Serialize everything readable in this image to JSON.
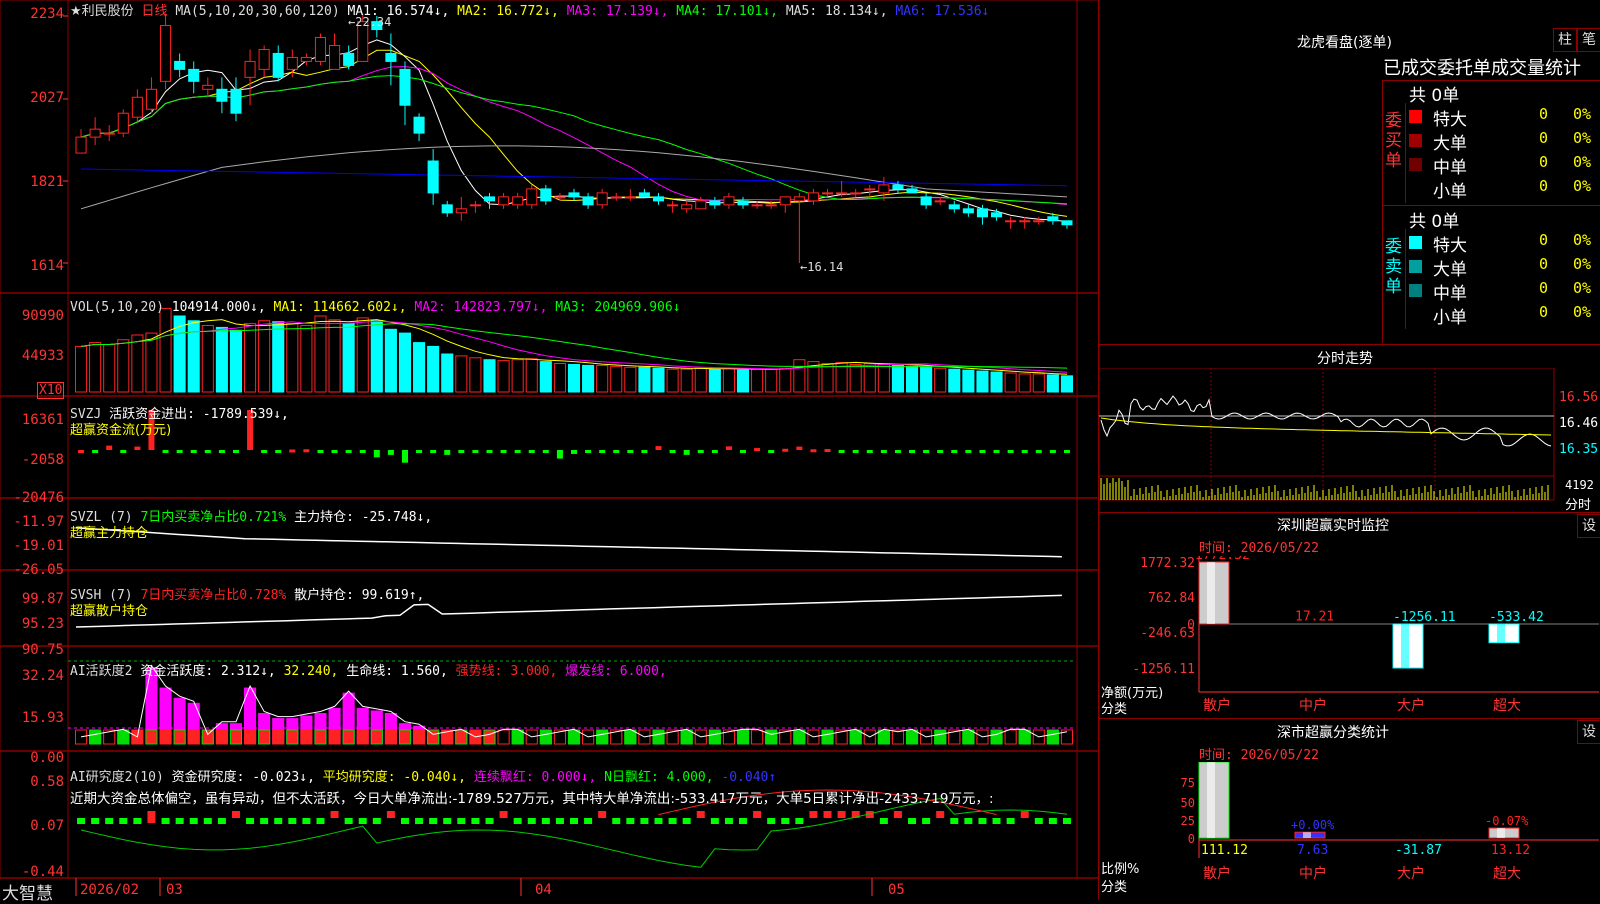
{
  "colors": {
    "up": "#ff2222",
    "down": "#00ffff",
    "bg": "#000000",
    "grid": "#8b0000",
    "ma1": "#ffffff",
    "ma2": "#ffff00",
    "ma3": "#ff00ff",
    "ma4": "#00ff00",
    "ma5": "#aaaaaa",
    "ma6": "#0000ff"
  },
  "header": {
    "stock": "★利民股份",
    "period": "日线",
    "ma_params": "MA(5,10,20,30,60,120)",
    "ma1": "MA1: 16.574↓,",
    "ma2": "MA2: 16.772↓,",
    "ma3": "MA3: 17.139↓,",
    "ma4": "MA4: 17.101↓,",
    "ma5": "MA5: 18.134↓,",
    "ma6": "MA6: 17.536↓"
  },
  "main_axis": {
    "ticks": [
      "2234",
      "2027",
      "1821",
      "1614"
    ]
  },
  "annotations": {
    "high": "←22.34",
    "low": "←16.14"
  },
  "vol": {
    "title": "VOL(5,10,20)",
    "value": "104914.000↓,",
    "ma1": "MA1: 114662.602↓,",
    "ma2": "MA2: 142823.797↓,",
    "ma3": "MA3: 204969.906↓",
    "ticks": [
      "90990",
      "44933"
    ],
    "unit": "X10"
  },
  "svzj": {
    "title": "SVZJ",
    "line1": "活跃资金进出: -1789.539↓,",
    "line2": "超赢资金流(万元)",
    "ticks": [
      "16361",
      "-2058",
      "-20476"
    ]
  },
  "svzl": {
    "title": "SVZL (7)",
    "pct": "7日内买卖净占比0.721%",
    "hold": "主力持仓: -25.748↓,",
    "line2": "超赢主力持仓",
    "ticks": [
      "-11.97",
      "-19.01",
      "-26.05"
    ]
  },
  "svsh": {
    "title": "SVSH (7)",
    "pct": "7日内买卖净占比0.728%",
    "hold": "散户持仓: 99.619↑,",
    "line2": "超赢散户持仓",
    "ticks": [
      "99.87",
      "95.23",
      "90.75"
    ]
  },
  "ai1": {
    "title": "AI活跃度2",
    "v1": "资金活跃度: 2.312↓,",
    "v2": "32.240,",
    "v3": "生命线: 1.560,",
    "v4": "强势线: 3.000,",
    "v5": "爆发线: 6.000,",
    "ticks": [
      "32.24",
      "15.93",
      "0.00"
    ]
  },
  "ai2": {
    "title": "AI研究度2(10)",
    "v1": "资金研究度: -0.023↓,",
    "v2": "平均研究度: -0.040↓,",
    "v3": "连续飘红: 0.000↓,",
    "v4": "N日飘红: 4.000,",
    "v5": "-0.040↑",
    "comment": "近期大资金总体偏空，虽有异动，但不太活跃，今日大单净流出:-1789.527万元，其中特大单净流出:-533.417万元，大单5日累计净出-2433.719万元，:",
    "ticks": [
      "0.58",
      "0.07",
      "-0.44"
    ]
  },
  "xaxis": {
    "brand": "大智慧",
    "labels": [
      "2026/02",
      "03",
      "04",
      "05"
    ]
  },
  "lhb": {
    "title": "龙虎看盘(逐单)",
    "btn1": "柱",
    "btn2": "笔",
    "subtitle": "已成交委托单成交量统计",
    "buy": {
      "side": "委买单",
      "total": "共 0单",
      "rows": [
        {
          "name": "特大",
          "v": "0",
          "p": "0%",
          "c": "#ff0000"
        },
        {
          "name": "大单",
          "v": "0",
          "p": "0%",
          "c": "#a00000"
        },
        {
          "name": "中单",
          "v": "0",
          "p": "0%",
          "c": "#700000"
        },
        {
          "name": "小单",
          "v": "0",
          "p": "0%",
          "c": ""
        }
      ]
    },
    "sell": {
      "side": "委卖单",
      "total": "共 0单",
      "rows": [
        {
          "name": "特大",
          "v": "0",
          "p": "0%",
          "c": "#00ffff"
        },
        {
          "name": "大单",
          "v": "0",
          "p": "0%",
          "c": "#00a0a0"
        },
        {
          "name": "中单",
          "v": "0",
          "p": "0%",
          "c": "#008080"
        },
        {
          "name": "小单",
          "v": "0",
          "p": "0%",
          "c": ""
        }
      ]
    }
  },
  "intraday": {
    "title": "分时走势",
    "ticks": [
      "16.56",
      "16.46",
      "16.35"
    ],
    "vol_tick": "4192",
    "unit": "分时"
  },
  "monitor": {
    "title": "深圳超赢实时监控",
    "btn": "设",
    "time": "时间: 2026/05/22",
    "ticks": [
      "1772.32",
      "762.84",
      "0",
      "-246.63",
      "-1256.11"
    ],
    "ylabel": "净额(万元)",
    "xlabel": "分类",
    "bars": [
      {
        "name": "散户",
        "value": 1772.32,
        "label": "1772.32"
      },
      {
        "name": "中户",
        "value": 17.21,
        "label": "17.21"
      },
      {
        "name": "大户",
        "value": -1256.11,
        "label": "-1256.11"
      },
      {
        "name": "超大",
        "value": -533.42,
        "label": "-533.42"
      }
    ]
  },
  "classify": {
    "title": "深市超赢分类统计",
    "btn": "设",
    "time": "时间: 2026/05/22",
    "ticks": [
      "75",
      "50",
      "25",
      "0"
    ],
    "ylabel": "比例%",
    "xlabel": "分类",
    "bars": [
      {
        "name": "散户",
        "value": 111.12,
        "label": "111.12",
        "top": ""
      },
      {
        "name": "中户",
        "value": 7.63,
        "label": "7.63",
        "top": "+0.00%"
      },
      {
        "name": "大户",
        "value": -31.87,
        "label": "-31.87",
        "top": ""
      },
      {
        "name": "超大",
        "value": 13.12,
        "label": "13.12",
        "top": "-0.07%"
      }
    ]
  },
  "chart_data": {
    "type": "candlestick",
    "title": "利民股份 日线",
    "ohlc": [
      [
        18.9,
        19.3,
        19.0,
        19.5
      ],
      [
        19.3,
        19.5,
        19.1,
        19.8
      ],
      [
        19.4,
        19.4,
        19.2,
        19.6
      ],
      [
        19.4,
        19.9,
        19.3,
        20.0
      ],
      [
        19.8,
        20.3,
        19.7,
        20.5
      ],
      [
        20.0,
        20.5,
        19.9,
        20.8
      ],
      [
        20.7,
        22.1,
        20.5,
        22.4
      ],
      [
        21.2,
        21.0,
        20.8,
        21.4
      ],
      [
        21.0,
        20.7,
        20.4,
        21.2
      ],
      [
        20.5,
        20.6,
        20.3,
        20.8
      ],
      [
        20.5,
        20.2,
        19.9,
        20.8
      ],
      [
        20.5,
        19.9,
        19.7,
        20.8
      ],
      [
        20.8,
        21.2,
        20.1,
        21.5
      ],
      [
        21.0,
        21.5,
        20.8,
        21.6
      ],
      [
        21.4,
        20.8,
        20.7,
        21.6
      ],
      [
        21.0,
        21.3,
        20.8,
        21.5
      ],
      [
        21.2,
        21.3,
        21.1,
        21.4
      ],
      [
        21.2,
        21.8,
        21.1,
        21.9
      ],
      [
        21.0,
        21.6,
        21.0,
        21.9
      ],
      [
        21.4,
        21.1,
        21.0,
        21.6
      ],
      [
        21.2,
        22.2,
        21.2,
        22.4
      ],
      [
        22.2,
        22.0,
        21.8,
        22.34
      ],
      [
        21.4,
        21.2,
        20.6,
        21.9
      ],
      [
        21.0,
        20.1,
        19.6,
        21.2
      ],
      [
        19.8,
        19.4,
        19.2,
        19.9
      ],
      [
        18.7,
        17.9,
        17.6,
        19.0
      ],
      [
        17.6,
        17.4,
        17.3,
        17.7
      ],
      [
        17.4,
        17.5,
        17.2,
        17.8
      ],
      [
        17.6,
        17.6,
        17.4,
        17.7
      ],
      [
        17.8,
        17.7,
        17.5,
        17.9
      ],
      [
        17.6,
        17.8,
        17.5,
        17.9
      ],
      [
        17.6,
        17.8,
        17.5,
        17.9
      ],
      [
        17.6,
        18.0,
        17.5,
        18.1
      ],
      [
        18.0,
        17.7,
        17.6,
        18.1
      ],
      [
        17.8,
        17.8,
        17.7,
        17.9
      ],
      [
        17.9,
        17.8,
        17.7,
        18.0
      ],
      [
        17.8,
        17.6,
        17.5,
        17.9
      ],
      [
        17.6,
        17.9,
        17.5,
        18.0
      ],
      [
        17.8,
        17.8,
        17.7,
        17.9
      ],
      [
        17.8,
        17.8,
        17.7,
        18.0
      ],
      [
        17.9,
        17.8,
        17.8,
        18.0
      ],
      [
        17.8,
        17.7,
        17.6,
        17.9
      ],
      [
        17.6,
        17.6,
        17.4,
        17.7
      ],
      [
        17.5,
        17.6,
        17.4,
        17.7
      ],
      [
        17.5,
        17.7,
        17.5,
        17.8
      ],
      [
        17.7,
        17.6,
        17.5,
        17.8
      ],
      [
        17.6,
        17.8,
        17.5,
        17.9
      ],
      [
        17.7,
        17.6,
        17.5,
        17.8
      ],
      [
        17.6,
        17.6,
        17.5,
        17.7
      ],
      [
        17.6,
        17.6,
        17.5,
        17.7
      ],
      [
        17.6,
        17.8,
        17.4,
        17.8
      ],
      [
        17.7,
        17.8,
        16.14,
        17.9
      ],
      [
        17.7,
        17.9,
        17.6,
        18.0
      ],
      [
        17.9,
        17.9,
        17.8,
        18.0
      ],
      [
        17.9,
        17.9,
        17.8,
        18.2
      ],
      [
        17.9,
        17.9,
        17.8,
        18.0
      ],
      [
        18.0,
        18.0,
        17.8,
        18.1
      ],
      [
        17.9,
        18.1,
        17.7,
        18.3
      ],
      [
        18.1,
        18.0,
        17.9,
        18.2
      ],
      [
        18.0,
        17.9,
        17.9,
        18.1
      ],
      [
        17.8,
        17.6,
        17.5,
        17.9
      ],
      [
        17.7,
        17.7,
        17.6,
        17.8
      ],
      [
        17.6,
        17.5,
        17.4,
        17.7
      ],
      [
        17.5,
        17.4,
        17.3,
        17.6
      ],
      [
        17.5,
        17.3,
        17.1,
        17.6
      ],
      [
        17.4,
        17.3,
        17.2,
        17.5
      ],
      [
        17.2,
        17.2,
        17.0,
        17.3
      ],
      [
        17.2,
        17.2,
        17.0,
        17.3
      ],
      [
        17.2,
        17.2,
        17.1,
        17.3
      ],
      [
        17.3,
        17.2,
        17.1,
        17.4
      ],
      [
        17.2,
        17.1,
        17.0,
        17.2
      ]
    ],
    "price_range": [
      16.14,
      22.34
    ],
    "volume": [
      48,
      52,
      50,
      55,
      60,
      62,
      88,
      80,
      75,
      70,
      68,
      65,
      72,
      75,
      74,
      72,
      70,
      80,
      76,
      72,
      78,
      75,
      66,
      62,
      52,
      48,
      40,
      38,
      36,
      34,
      33,
      34,
      35,
      32,
      30,
      29,
      28,
      28,
      27,
      26,
      26,
      25,
      24,
      24,
      25,
      24,
      25,
      23,
      24,
      24,
      25,
      34,
      32,
      30,
      31,
      29,
      30,
      29,
      28,
      27,
      26,
      25,
      24,
      23,
      22,
      21,
      20,
      19,
      19,
      18,
      17
    ],
    "vol_max": 90990,
    "svzj": [
      0,
      -1200,
      1800,
      -900,
      1400,
      16361,
      -500,
      -300,
      -200,
      -300,
      -700,
      -200,
      16361,
      -1200,
      -500,
      200,
      300,
      -400,
      -600,
      -800,
      -1200,
      -3000,
      -2000,
      -5200,
      -900,
      -300,
      -2000,
      -400,
      -200,
      -100,
      -200,
      -100,
      -300,
      -800,
      -3500,
      -1600,
      -200,
      -300,
      -100,
      -200,
      -300,
      1600,
      -200,
      -2000,
      -100,
      -200,
      1500,
      -1000,
      800,
      -600,
      500,
      1400,
      300,
      400,
      -100,
      -200,
      -300,
      -800,
      -500,
      -400,
      -800,
      -500,
      -1000,
      -300,
      -400,
      -600,
      -200,
      -200,
      -300,
      -100,
      -500
    ]
  }
}
